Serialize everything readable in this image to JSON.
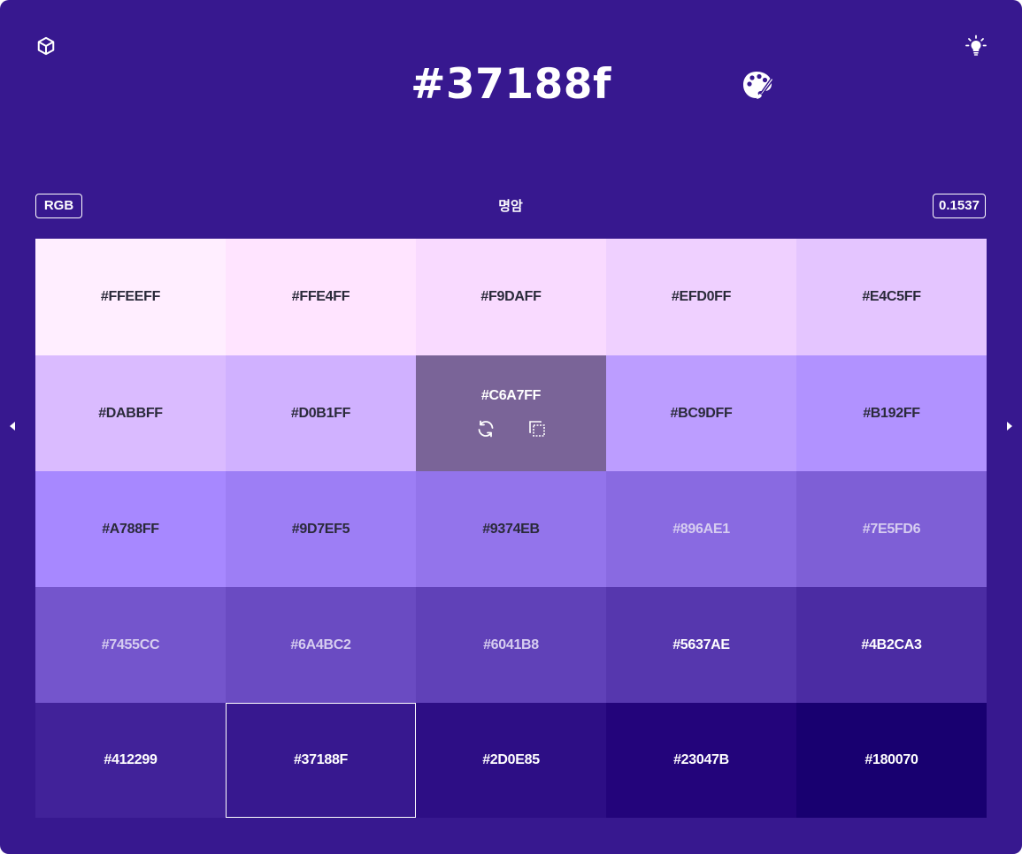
{
  "header": {
    "hex": "#37188f",
    "mode_label": "RGB",
    "control_label": "명암",
    "value": "0.1537",
    "icons": [
      "cube-icon",
      "lightbulb-icon",
      "palette-icon",
      "chevron-left-icon",
      "chevron-right-icon",
      "refresh-icon",
      "copy-icon"
    ]
  },
  "colors": {
    "background": "#37188f",
    "dark_text": "#2a2a3a",
    "light_text": "#ffffff"
  },
  "swatches": [
    {
      "label": "#FFEEFF",
      "color": "#ffeeff",
      "text": "#2a2a3a"
    },
    {
      "label": "#FFE4FF",
      "color": "#ffe4ff",
      "text": "#2a2a3a"
    },
    {
      "label": "#F9DAFF",
      "color": "#f9daff",
      "text": "#2a2a3a"
    },
    {
      "label": "#EFD0FF",
      "color": "#efd0ff",
      "text": "#2a2a3a"
    },
    {
      "label": "#E4C5FF",
      "color": "#e4c5ff",
      "text": "#2a2a3a"
    },
    {
      "label": "#DABBFF",
      "color": "#dabbff",
      "text": "#2a2a3a"
    },
    {
      "label": "#D0B1FF",
      "color": "#d0b1ff",
      "text": "#2a2a3a"
    },
    {
      "label": "#C6A7FF",
      "color": "#7a6498",
      "text": "#ffffff",
      "hovered": true
    },
    {
      "label": "#BC9DFF",
      "color": "#bc9dff",
      "text": "#2a2a3a"
    },
    {
      "label": "#B192FF",
      "color": "#b192ff",
      "text": "#2a2a3a"
    },
    {
      "label": "#A788FF",
      "color": "#a788ff",
      "text": "#2a2a3a"
    },
    {
      "label": "#9D7EF5",
      "color": "#9d7ef5",
      "text": "#2a2a3a"
    },
    {
      "label": "#9374EB",
      "color": "#9374eb",
      "text": "#2a2a3a"
    },
    {
      "label": "#896AE1",
      "color": "#896ae1",
      "text": "#d6cdf0"
    },
    {
      "label": "#7E5FD6",
      "color": "#7e5fd6",
      "text": "#d6cdf0"
    },
    {
      "label": "#7455CC",
      "color": "#7455cc",
      "text": "#d6cdf0"
    },
    {
      "label": "#6A4BC2",
      "color": "#6a4bc2",
      "text": "#d6cdf0"
    },
    {
      "label": "#6041B8",
      "color": "#6041b8",
      "text": "#d6cdf0"
    },
    {
      "label": "#5637AE",
      "color": "#5637ae",
      "text": "#ffffff"
    },
    {
      "label": "#4B2CA3",
      "color": "#4b2ca3",
      "text": "#ffffff"
    },
    {
      "label": "#412299",
      "color": "#412299",
      "text": "#ffffff"
    },
    {
      "label": "#37188F",
      "color": "#37188f",
      "text": "#ffffff",
      "selected": true
    },
    {
      "label": "#2D0E85",
      "color": "#2d0e85",
      "text": "#ffffff"
    },
    {
      "label": "#23047B",
      "color": "#23047b",
      "text": "#ffffff"
    },
    {
      "label": "#180070",
      "color": "#180070",
      "text": "#ffffff"
    }
  ]
}
